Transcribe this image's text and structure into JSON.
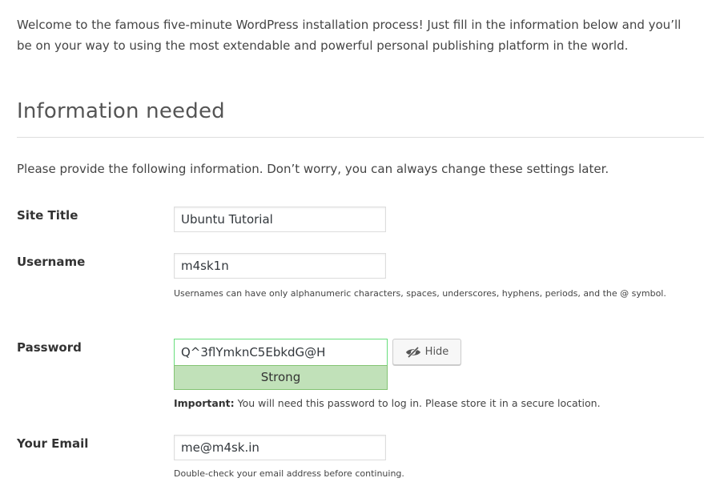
{
  "intro": {
    "text": "Welcome to the famous five-minute WordPress installation process! Just fill in the information below and you’ll be on your way to using the most extendable and powerful personal publishing platform in the world."
  },
  "section": {
    "title": "Information needed",
    "note": "Please provide the following information. Don’t worry, you can always change these settings later."
  },
  "form": {
    "site_title": {
      "label": "Site Title",
      "value": "Ubuntu Tutorial"
    },
    "username": {
      "label": "Username",
      "value": "m4sk1n",
      "description": "Usernames can have only alphanumeric characters, spaces, underscores, hyphens, periods, and the @ symbol."
    },
    "password": {
      "label": "Password",
      "value": "Q^3flYmknC5EbkdG@H",
      "hide_label": "Hide",
      "strength": "Strong",
      "important_label": "Important:",
      "important_text": " You will need this password to log in. Please store it in a secure location.",
      "strength_color": "#c1e1b9",
      "strength_border_color": "#83c373",
      "field_border_color": "#68de7c",
      "hide_icon": "hidden-eye-icon"
    },
    "email": {
      "label": "Your Email",
      "value": "me@m4sk.in",
      "description": "Double-check your email address before continuing."
    }
  }
}
